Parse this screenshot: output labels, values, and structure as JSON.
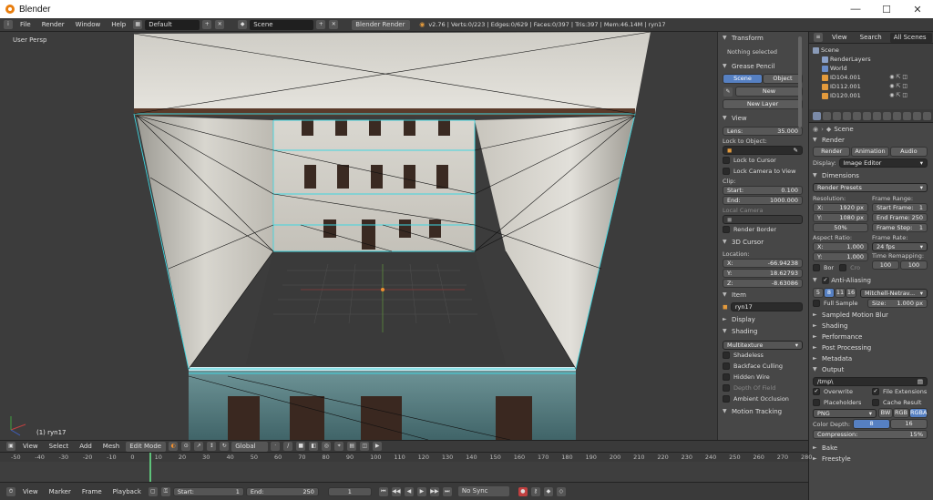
{
  "window": {
    "title": "Blender"
  },
  "topbar": {
    "menus": [
      "File",
      "Render",
      "Window",
      "Help"
    ],
    "screen_layout": "Default",
    "scene": "Scene",
    "engine": "Blender Render",
    "stats": "v2.76 | Verts:0/223 | Edges:0/629 | Faces:0/397 | Tris:397 | Mem:46.14M | ryn17"
  },
  "viewport": {
    "view_label": "User Persp",
    "object_label": "(1) ryn17"
  },
  "viewport_header": {
    "menus": [
      "View",
      "Select",
      "Add",
      "Mesh"
    ],
    "mode": "Edit Mode",
    "orientation": "Global"
  },
  "npanel": {
    "transform": {
      "title": "Transform",
      "status": "Nothing selected"
    },
    "grease_pencil": {
      "title": "Grease Pencil",
      "tab_scene": "Scene",
      "tab_object": "Object",
      "new": "New",
      "new_layer": "New Layer"
    },
    "view": {
      "title": "View",
      "lens_label": "Lens:",
      "lens_value": "35.000",
      "lock_to_object": "Lock to Object:",
      "lock_to_cursor": "Lock to Cursor",
      "lock_camera": "Lock Camera to View",
      "clip": "Clip:",
      "clip_start_label": "Start:",
      "clip_start": "0.100",
      "clip_end_label": "End:",
      "clip_end": "1000.000",
      "local_camera": "Local Camera",
      "render_border": "Render Border"
    },
    "cursor": {
      "title": "3D Cursor",
      "location": "Location:",
      "x_label": "X:",
      "x": "-66.94238",
      "y_label": "Y:",
      "y": "18.62793",
      "z_label": "Z:",
      "z": "-8.63086"
    },
    "item": {
      "title": "Item",
      "name": "ryn17"
    },
    "display": {
      "title": "Display"
    },
    "shading": {
      "title": "Shading",
      "mode": "Multitexture",
      "shadeless": "Shadeless",
      "backface": "Backface Culling",
      "hidden_wire": "Hidden Wire",
      "depth_of_field": "Depth Of Field",
      "ambient_occlusion": "Ambient Occlusion"
    },
    "motion_tracking": {
      "title": "Motion Tracking"
    }
  },
  "outliner": {
    "menus": [
      "View",
      "Search"
    ],
    "filter": "All Scenes",
    "items": [
      {
        "label": "Scene",
        "indent": 0,
        "color": "#8a9bb8"
      },
      {
        "label": "RenderLayers",
        "indent": 1,
        "color": "#8aa0c8"
      },
      {
        "label": "World",
        "indent": 1,
        "color": "#6a8cc8"
      },
      {
        "label": "ID104.001",
        "indent": 1,
        "color": "#e39a3c"
      },
      {
        "label": "ID112.001",
        "indent": 1,
        "color": "#e39a3c"
      },
      {
        "label": "ID120.001",
        "indent": 1,
        "color": "#e39a3c"
      }
    ]
  },
  "props": {
    "scene_name": "Scene",
    "render": {
      "title": "Render",
      "render_btn": "Render",
      "animation_btn": "Animation",
      "audio_btn": "Audio",
      "display_label": "Display:",
      "display_value": "Image Editor"
    },
    "dimensions": {
      "title": "Dimensions",
      "presets": "Render Presets",
      "resolution": "Resolution:",
      "res_x_label": "X:",
      "res_x": "1920 px",
      "res_y_label": "Y:",
      "res_y": "1080 px",
      "res_pct": "50%",
      "frame_range": "Frame Range:",
      "start_label": "Start Frame:",
      "start": "1",
      "end_label": "End Frame:",
      "end": "250",
      "step_label": "Frame Step:",
      "step": "1",
      "aspect": "Aspect Ratio:",
      "asp_x_label": "X:",
      "asp_x": "1.000",
      "asp_y_label": "Y:",
      "asp_y": "1.000",
      "frame_rate": "Frame Rate:",
      "fps": "24 fps",
      "time_remap": "Time Remapping:",
      "remap_old": "100",
      "remap_new": "100",
      "border": "Bor",
      "crop": "Cro"
    },
    "anti_aliasing": {
      "title": "Anti-Aliasing",
      "samples": [
        "5",
        "8",
        "11",
        "16"
      ],
      "filter": "Mitchell-Netrav...",
      "full_sample": "Full Sample",
      "size_label": "Size:",
      "size": "1.000 px"
    },
    "collapsed": [
      "Sampled Motion Blur",
      "Shading",
      "Performance",
      "Post Processing",
      "Metadata"
    ],
    "output": {
      "title": "Output",
      "path": "/tmp\\",
      "overwrite": "Overwrite",
      "file_extensions": "File Extensions",
      "placeholders": "Placeholders",
      "cache_result": "Cache Result",
      "format": "PNG",
      "bw": "BW",
      "rgb": "RGB",
      "rgba": "RGBA",
      "color_depth_label": "Color Depth:",
      "depth_8": "8",
      "depth_16": "16",
      "compression_label": "Compression:",
      "compression": "15%"
    },
    "bake": {
      "title": "Bake"
    },
    "freestyle": {
      "title": "Freestyle"
    }
  },
  "timeline": {
    "ruler": [
      "-50",
      "-40",
      "-30",
      "-20",
      "-10",
      "0",
      "10",
      "20",
      "30",
      "40",
      "50",
      "60",
      "70",
      "80",
      "90",
      "100",
      "110",
      "120",
      "130",
      "140",
      "150",
      "160",
      "170",
      "180",
      "190",
      "200",
      "210",
      "220",
      "230",
      "240",
      "250",
      "260",
      "270",
      "280"
    ],
    "current_frame_pos": 0.185
  },
  "timeline_header": {
    "menus": [
      "View",
      "Marker",
      "Frame",
      "Playback"
    ],
    "start_label": "Start:",
    "start": "1",
    "end_label": "End:",
    "end": "250",
    "current": "1",
    "sync": "No Sync"
  },
  "colors": {
    "accent": "#5680c2",
    "wire": "#3fd6e0",
    "panel_bg": "#474747",
    "viewport_bg": "#3c3c3c"
  }
}
